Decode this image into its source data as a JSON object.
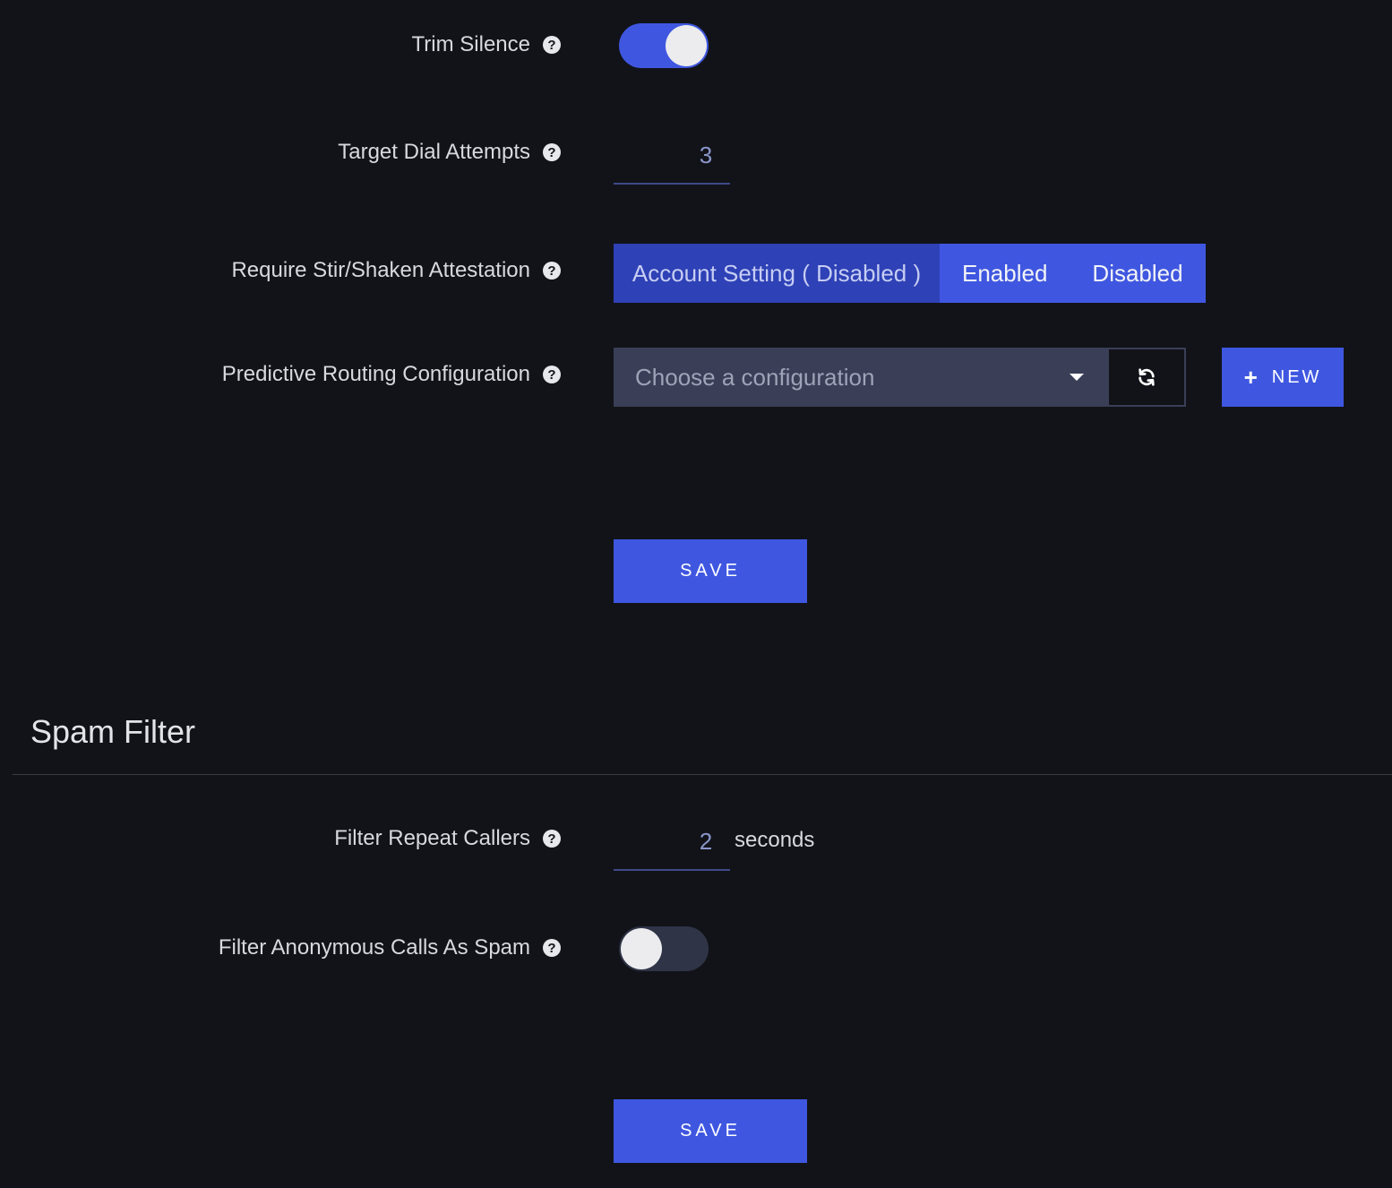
{
  "trim_silence": {
    "label": "Trim Silence",
    "help_icon": "question-circle-icon",
    "enabled": true
  },
  "target_dial_attempts": {
    "label": "Target Dial Attempts",
    "help_icon": "question-circle-icon",
    "value": "3"
  },
  "stir_shaken": {
    "label": "Require Stir/Shaken Attestation",
    "help_icon": "question-circle-icon",
    "options": [
      "Account Setting ( Disabled )",
      "Enabled",
      "Disabled"
    ],
    "selected": "Account Setting ( Disabled )"
  },
  "predictive_routing": {
    "label": "Predictive Routing Configuration",
    "help_icon": "question-circle-icon",
    "placeholder": "Choose a configuration",
    "refresh_icon": "refresh-icon",
    "new_label": "NEW",
    "new_icon": "plus-icon"
  },
  "routing_section": {
    "save_label": "SAVE"
  },
  "spam_filter": {
    "title": "Spam Filter",
    "filter_repeat_callers": {
      "label": "Filter Repeat Callers",
      "help_icon": "question-circle-icon",
      "value": "2",
      "unit": "seconds"
    },
    "filter_anonymous": {
      "label": "Filter Anonymous Calls As Spam",
      "help_icon": "question-circle-icon",
      "enabled": false
    },
    "save_label": "SAVE"
  },
  "colors": {
    "background": "#121319",
    "accent": "#3f57e0",
    "accent_selected": "#2e41b6",
    "select_bg": "#3a3f57"
  }
}
